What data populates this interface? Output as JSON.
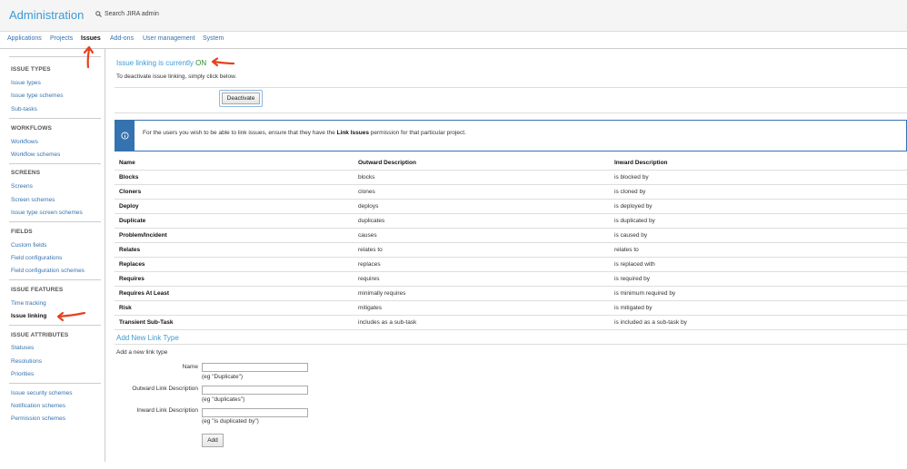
{
  "header": {
    "title": "Administration",
    "search_placeholder": "Search JIRA admin"
  },
  "nav": {
    "items": [
      "Applications",
      "Projects",
      "Issues",
      "Add-ons",
      "User management",
      "System"
    ]
  },
  "sidebar": {
    "sections": [
      {
        "heading": "ISSUE TYPES",
        "items": [
          "Issue types",
          "Issue type schemes",
          "Sub-tasks"
        ]
      },
      {
        "heading": "WORKFLOWS",
        "items": [
          "Workflows",
          "Workflow schemes"
        ]
      },
      {
        "heading": "SCREENS",
        "items": [
          "Screens",
          "Screen schemes",
          "Issue type screen schemes"
        ]
      },
      {
        "heading": "FIELDS",
        "items": [
          "Custom fields",
          "Field configurations",
          "Field configuration schemes"
        ]
      },
      {
        "heading": "ISSUE FEATURES",
        "items": [
          "Time tracking",
          "Issue linking"
        ]
      },
      {
        "heading": "ISSUE ATTRIBUTES",
        "items": [
          "Statuses",
          "Resolutions",
          "Priorities"
        ]
      },
      {
        "heading": "",
        "items": [
          "Issue security schemes",
          "Notification schemes",
          "Permission schemes"
        ]
      }
    ]
  },
  "linking": {
    "title_prefix": "Issue linking is currently",
    "status": "ON",
    "instruction": "To deactivate issue linking, simply click below.",
    "deactivate_label": "Deactivate"
  },
  "info": {
    "text_before": "For the users you wish to be able to link issues, ensure that they have the",
    "text_bold": "Link Issues",
    "text_after": "permission for that particular project."
  },
  "table": {
    "headers": [
      "Name",
      "Outward Description",
      "Inward Description"
    ],
    "rows": [
      [
        "Blocks",
        "blocks",
        "is blocked by"
      ],
      [
        "Cloners",
        "clones",
        "is cloned by"
      ],
      [
        "Deploy",
        "deploys",
        "is deployed by"
      ],
      [
        "Duplicate",
        "duplicates",
        "is duplicated by"
      ],
      [
        "Problem/Incident",
        "causes",
        "is caused by"
      ],
      [
        "Relates",
        "relates to",
        "relates to"
      ],
      [
        "Replaces",
        "replaces",
        "is replaced with"
      ],
      [
        "Requires",
        "requires",
        "is required by"
      ],
      [
        "Requires At Least",
        "minimally requires",
        "is minimum required by"
      ],
      [
        "Risk",
        "mitigates",
        "is mitigated by"
      ],
      [
        "Transient Sub-Task",
        "includes as a sub-task",
        "is included as a sub-task by"
      ]
    ]
  },
  "add_form": {
    "title": "Add New Link Type",
    "subtitle": "Add a new link type",
    "name_label": "Name",
    "name_hint": "(eg \"Duplicate\")",
    "outward_label": "Outward Link Description",
    "outward_hint": "(eg \"duplicates\")",
    "inward_label": "Inward Link Description",
    "inward_hint": "(eg \"is duplicated by\")",
    "add_label": "Add"
  },
  "colors": {
    "link": "#3572b0",
    "accent": "#3b9bd6",
    "on": "#2e8b2e",
    "annotation_arrow": "#e8401c"
  }
}
